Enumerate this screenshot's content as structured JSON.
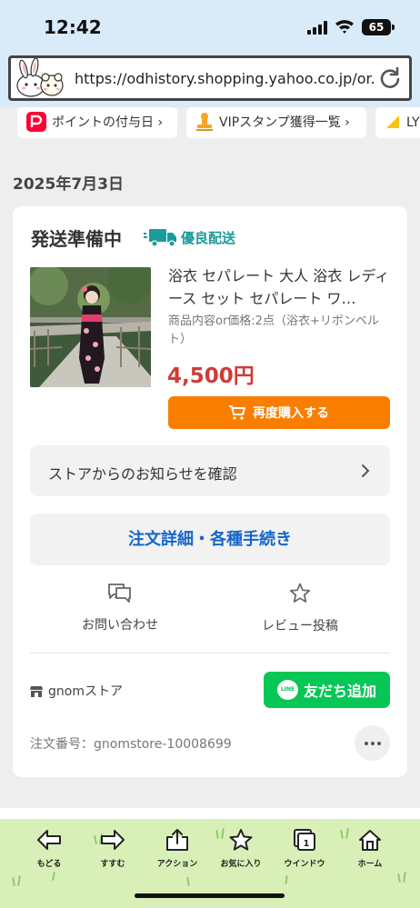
{
  "status_bar": {
    "time": "12:42",
    "battery": "65"
  },
  "browser": {
    "url": "https://odhistory.shopping.yahoo.co.jp/or..."
  },
  "chips": [
    {
      "label": "ポイントの付与日 ›"
    },
    {
      "label": "VIPスタンプ獲得一覧 ›"
    },
    {
      "label": "LY"
    }
  ],
  "order_date": "2025年7月3日",
  "order": {
    "status": "発送準備中",
    "badge": "優良配送",
    "product_name": "浴衣 セパレート 大人 浴衣 レディース セット セパレート ワ…",
    "product_note": "商品内容or価格:2点（浴衣+リボンベルト）",
    "price": "4,500円",
    "rebuy_label": "再度購入する",
    "notice_label": "ストアからのお知らせを確認",
    "detail_label": "注文詳細・各種手続き",
    "actions": {
      "inquiry": "お問い合わせ",
      "review": "レビュー投稿"
    },
    "store_name": "gnomストア",
    "line_label": "友だち追加",
    "line_logo": "LINE",
    "order_number": "注文番号：gnomstore-10008699"
  },
  "toolbar": {
    "back": "もどる",
    "forward": "すすむ",
    "action": "アクション",
    "favorite": "お気に入り",
    "window": "ウインドウ",
    "window_count": "1",
    "home": "ホーム"
  },
  "colors": {
    "accent_orange": "#f97e00",
    "price_red": "#d03b35",
    "line_green": "#06c755",
    "link_blue": "#1366c8",
    "badge_teal": "#1a9c9a",
    "toolbar_bg": "#d8f0b8"
  }
}
